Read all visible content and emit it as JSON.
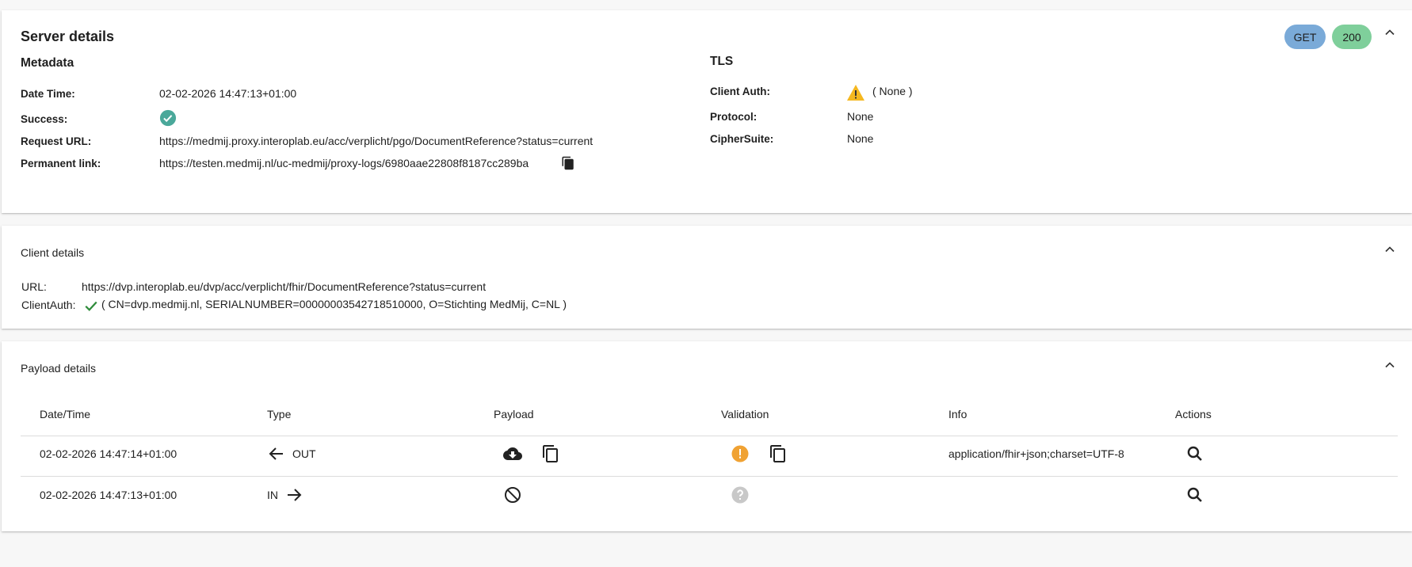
{
  "server": {
    "title": "Server details",
    "method": "GET",
    "status_code": "200",
    "metadata": {
      "heading": "Metadata",
      "date_time_label": "Date Time:",
      "date_time": "02-02-2026 14:47:13+01:00",
      "success_label": "Success:",
      "success_icon": "check-circle-icon",
      "request_url_label": "Request URL:",
      "request_url": "https://medmij.proxy.interoplab.eu/acc/verplicht/pgo/DocumentReference?status=current",
      "permanent_link_label": "Permanent link:",
      "permanent_link": "https://testen.medmij.nl/uc-medmij/proxy-logs/6980aae22808f8187cc289ba"
    },
    "tls": {
      "heading": "TLS",
      "client_auth_label": "Client Auth:",
      "client_auth": "( None )",
      "protocol_label": "Protocol:",
      "protocol": "None",
      "cipher_label": "CipherSuite:",
      "cipher": "None"
    }
  },
  "client": {
    "title": "Client details",
    "url_label": "URL:",
    "url": "https://dvp.interoplab.eu/dvp/acc/verplicht/fhir/DocumentReference?status=current",
    "auth_label": "ClientAuth:",
    "auth": "( CN=dvp.medmij.nl, SERIALNUMBER=00000003542718510000, O=Stichting MedMij, C=NL )"
  },
  "payload": {
    "title": "Payload details",
    "columns": [
      "Date/Time",
      "Type",
      "Payload",
      "Validation",
      "Info",
      "Actions"
    ],
    "rows": [
      {
        "datetime": "02-02-2026 14:47:14+01:00",
        "type": "OUT",
        "info": "application/fhir+json;charset=UTF-8"
      },
      {
        "datetime": "02-02-2026 14:47:13+01:00",
        "type": "IN",
        "info": ""
      }
    ]
  },
  "colors": {
    "get_pill": "#7aaad8",
    "status_pill": "#7fcf9b",
    "success": "#4aa89a",
    "warning": "#f5b820",
    "validation_warning": "#f0a233",
    "validation_unknown": "#c8c8c8",
    "client_ok": "#2e8b3a"
  }
}
